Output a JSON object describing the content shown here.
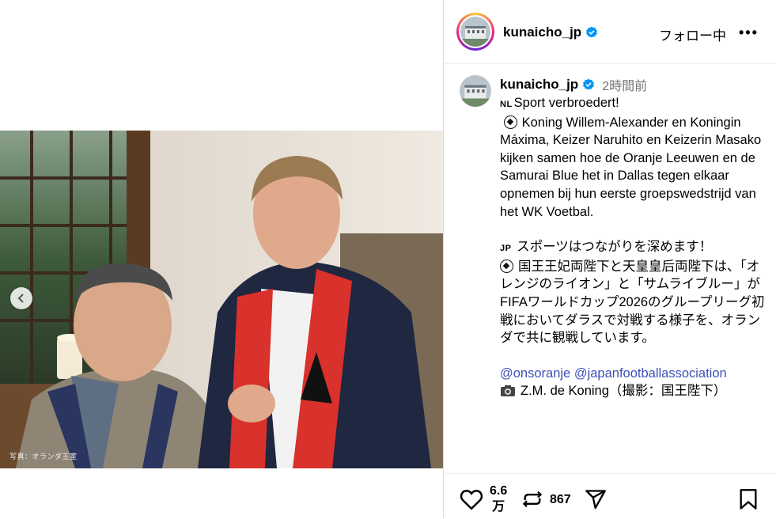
{
  "post": {
    "username": "kunaicho_jp",
    "follow_status": "フォロー中",
    "more": "•••",
    "time_ago": "2時間前",
    "photo_credit": "写真：オランダ王室"
  },
  "caption": {
    "nl_flag": "NL",
    "nl_title": "Sport verbroedert!",
    "nl_body": "Koning Willem-Alexander en Koningin Máxima, Keizer Naruhito en Keizerin Masako kijken samen hoe de Oranje Leeuwen en de Samurai Blue het in Dallas tegen elkaar opnemen bij hun eerste groepswedstrijd van het WK Voetbal.",
    "jp_flag": "JP",
    "jp_title": "スポーツはつながりを深めます！",
    "jp_body": "国王王妃両陛下と天皇皇后両陛下は、「オレンジのライオン」と「サムライブルー」がFIFAワールドカップ2026のグループリーグ初戦においてダラスで対戦する様子を、オランダで共に観戦しています。",
    "mention_1": "@onsoranje",
    "mention_2": "@japanfootballassociation",
    "camera_credit": "Z.M. de Koning（撮影：国王陛下）"
  },
  "actions": {
    "likes": "6.6万",
    "likes_line1": "6.6",
    "likes_line2": "万",
    "reposts": "867"
  },
  "colors": {
    "verified_blue": "#0095f6",
    "mention_blue": "#3f51b5",
    "border": "#dbdbdb",
    "muted": "#737373"
  },
  "icons": [
    "chevron-left-icon",
    "verified-badge-icon",
    "more-icon",
    "heart-icon",
    "repost-icon",
    "share-icon",
    "bookmark-icon",
    "soccer-ball-icon",
    "camera-icon"
  ]
}
